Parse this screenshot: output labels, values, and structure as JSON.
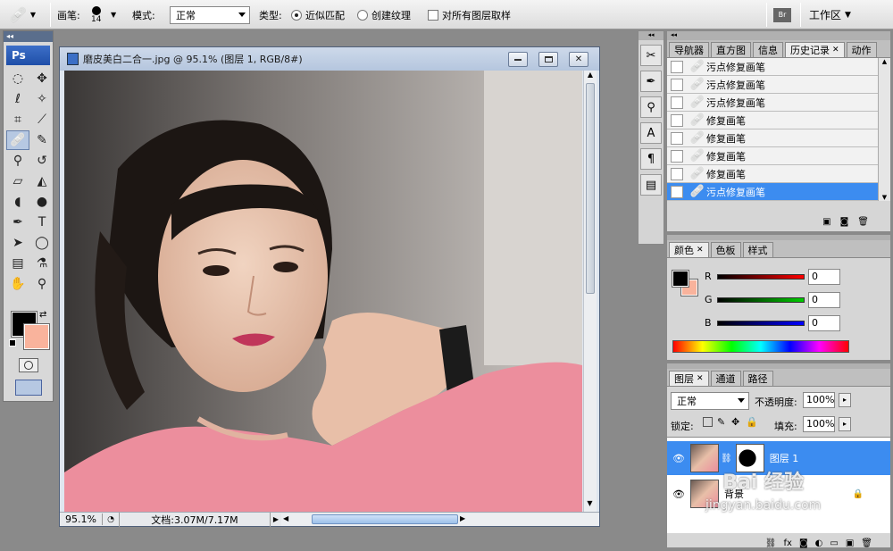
{
  "options_bar": {
    "brush_label": "画笔:",
    "brush_size": "14",
    "mode_label": "模式:",
    "mode_value": "正常",
    "type_label": "类型:",
    "type_opt1": "近似匹配",
    "type_opt2": "创建纹理",
    "sample_all_label": "对所有图层取样",
    "workspace_label": "工作区"
  },
  "toolbox": {
    "logo": "Ps"
  },
  "document": {
    "title": "磨皮美白二合一.jpg @ 95.1% (图层 1, RGB/8#)",
    "zoom": "95.1%",
    "doc_info": "文档:3.07M/7.17M"
  },
  "history_panel": {
    "tabs": [
      "导航器",
      "直方图",
      "信息",
      "历史记录",
      "动作"
    ],
    "items": [
      "污点修复画笔",
      "污点修复画笔",
      "污点修复画笔",
      "修复画笔",
      "修复画笔",
      "修复画笔",
      "修复画笔",
      "污点修复画笔"
    ]
  },
  "color_panel": {
    "tabs": [
      "颜色",
      "色板",
      "样式"
    ],
    "r_label": "R",
    "g_label": "G",
    "b_label": "B",
    "r_value": "0",
    "g_value": "0",
    "b_value": "0",
    "fg_color": "#000000",
    "bg_color": "#f9b39c"
  },
  "layers_panel": {
    "tabs": [
      "图层",
      "通道",
      "路径"
    ],
    "blend_mode": "正常",
    "opacity_label": "不透明度:",
    "opacity_value": "100%",
    "lock_label": "锁定:",
    "fill_label": "填充:",
    "fill_value": "100%",
    "layer1_name": "图层 1",
    "layer_bg_name": "背景"
  },
  "watermark": {
    "line1": "Bai 经验",
    "line2": "jingyan.baidu.com"
  }
}
